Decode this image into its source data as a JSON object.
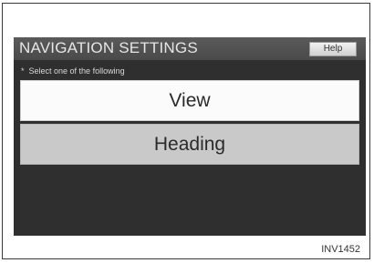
{
  "screen": {
    "title": "NAVIGATION SETTINGS",
    "help_label": "Help",
    "prompt_bullet": "*",
    "prompt_text": "Select one of the following"
  },
  "options": [
    {
      "label": "View",
      "highlighted": false
    },
    {
      "label": "Heading",
      "highlighted": true
    }
  ],
  "figure": {
    "code": "INV1452"
  },
  "colors": {
    "screen_background": "#2f2f2f",
    "title_bar": "#4f4f4f",
    "option_normal": "#fbfbfb",
    "option_highlighted": "#c9c9c9"
  }
}
